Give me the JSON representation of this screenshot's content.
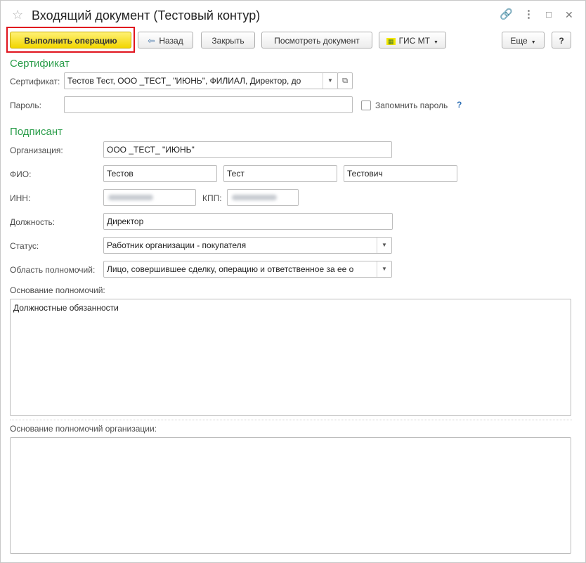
{
  "window": {
    "title": "Входящий документ (Тестовый контур)"
  },
  "toolbar": {
    "execute_label": "Выполнить операцию",
    "back_label": "Назад",
    "close_label": "Закрыть",
    "view_document_label": "Посмотреть документ",
    "gis_label": "ГИС МТ",
    "more_label": "Еще",
    "help_label": "?"
  },
  "icons": {
    "star": "☆",
    "link": "🔗",
    "menu": "⋮",
    "minimize": "□",
    "close": "✕",
    "dropdown": "▼",
    "open": "⧉",
    "back": "⇦",
    "gis": "▦"
  },
  "certificate": {
    "section_title": "Сертификат",
    "cert_label": "Сертификат:",
    "cert_value": "Тестов Тест, ООО _ТЕСТ_ \"ИЮНЬ\", ФИЛИАЛ, Директор, до",
    "password_label": "Пароль:",
    "password_value": "",
    "remember_label": "Запомнить пароль",
    "help": "?"
  },
  "signer": {
    "section_title": "Подписант",
    "org_label": "Организация:",
    "org_value": "ООО _ТЕСТ_ \"ИЮНЬ\"",
    "fio_label": "ФИО:",
    "last_name": "Тестов",
    "first_name": "Тест",
    "middle_name": "Тестович",
    "inn_label": "ИНН:",
    "kpp_label": "КПП:",
    "position_label": "Должность:",
    "position_value": "Директор",
    "status_label": "Статус:",
    "status_value": "Работник организации - покупателя",
    "scope_label": "Область полномочий:",
    "scope_value": "Лицо, совершившее сделку, операцию и ответственное за ее о",
    "basis_label": "Основание полномочий:",
    "basis_value": "Должностные обязанности",
    "org_basis_label": "Основание полномочий организации:",
    "org_basis_value": ""
  },
  "colors": {
    "section": "#2a9d4a",
    "primary_button": "#f2d600",
    "highlight": "#e0141e",
    "help_link": "#2f6fb5"
  }
}
